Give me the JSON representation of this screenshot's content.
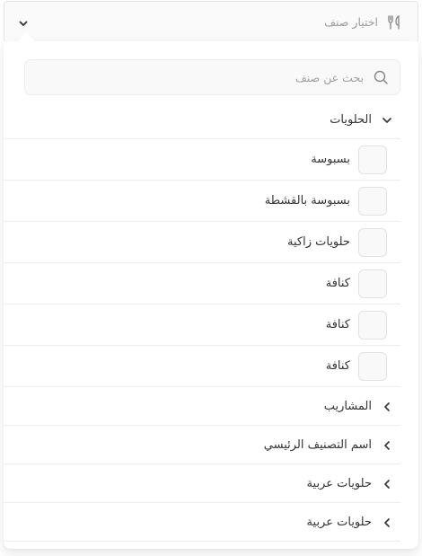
{
  "select": {
    "placeholder": "اختيار صنف",
    "lead_icon": "utensils-icon",
    "caret_icon": "chevron-down-icon"
  },
  "search": {
    "placeholder": "بحث عن صنف",
    "icon": "search-icon"
  },
  "open_category": {
    "label": "الحلويات",
    "items": [
      {
        "label": "بسبوسة",
        "checked": false
      },
      {
        "label": "بسبوسة بالقشطة",
        "checked": false
      },
      {
        "label": "حلويات زاكية",
        "checked": false
      },
      {
        "label": "كنافة",
        "checked": false
      },
      {
        "label": "كنافة",
        "checked": false
      },
      {
        "label": "كنافة",
        "checked": false
      }
    ]
  },
  "collapsed_categories": [
    {
      "label": "المشاريب"
    },
    {
      "label": "اسم التصنيف الرئيسي"
    },
    {
      "label": "حلويات عربية"
    },
    {
      "label": "حلويات عربية"
    }
  ]
}
